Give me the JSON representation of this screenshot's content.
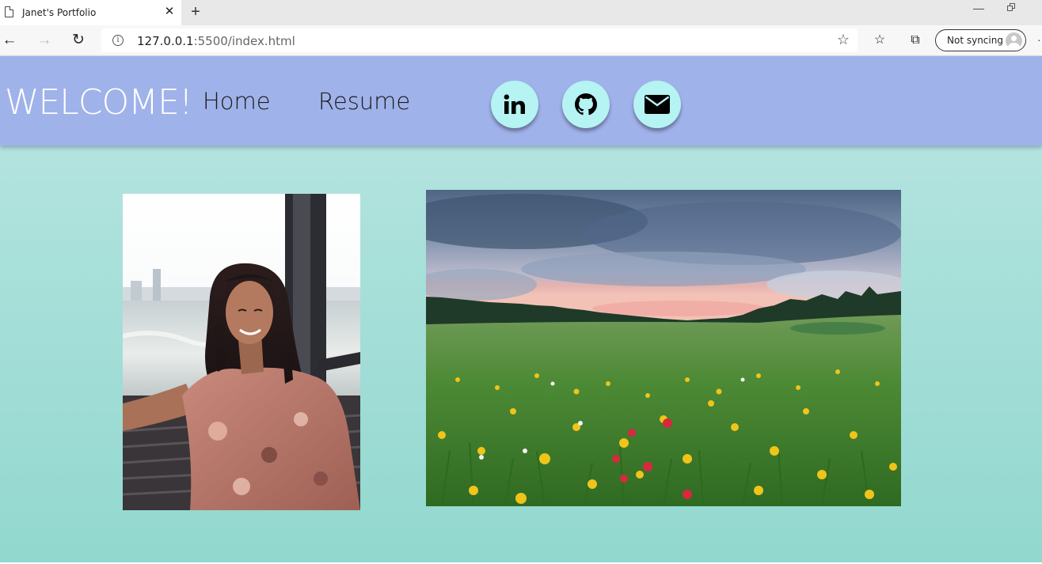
{
  "browser": {
    "tab_title": "Janet's Portfolio",
    "url_host": "127.0.0.1",
    "url_rest": ":5500/index.html",
    "sync_label": "Not syncing",
    "icons": [
      "page-icon",
      "close-icon",
      "plus-icon",
      "back-arrow-icon",
      "forward-arrow-icon",
      "refresh-icon",
      "info-icon",
      "star-icon",
      "favorites-icon",
      "collections-icon",
      "profile-icon"
    ]
  },
  "header": {
    "welcome": "WELCOME!",
    "nav": [
      {
        "label": "Home"
      },
      {
        "label": "Resume"
      }
    ],
    "social": [
      {
        "icon": "linkedin-icon"
      },
      {
        "icon": "github-icon"
      },
      {
        "icon": "envelope-icon"
      }
    ],
    "colors": {
      "header_bg": "#a0b2ea",
      "social_bg": "#b6f3f3",
      "page_bg_top": "#bde6e2",
      "page_bg_bottom": "#92d8cf"
    }
  },
  "images": [
    {
      "name": "portrait-photo",
      "description": "woman with long dark hair in floral dress seated by a boat window"
    },
    {
      "name": "meadow-photo",
      "description": "wildflower meadow with pine forest under cloudy sunset sky"
    }
  ]
}
